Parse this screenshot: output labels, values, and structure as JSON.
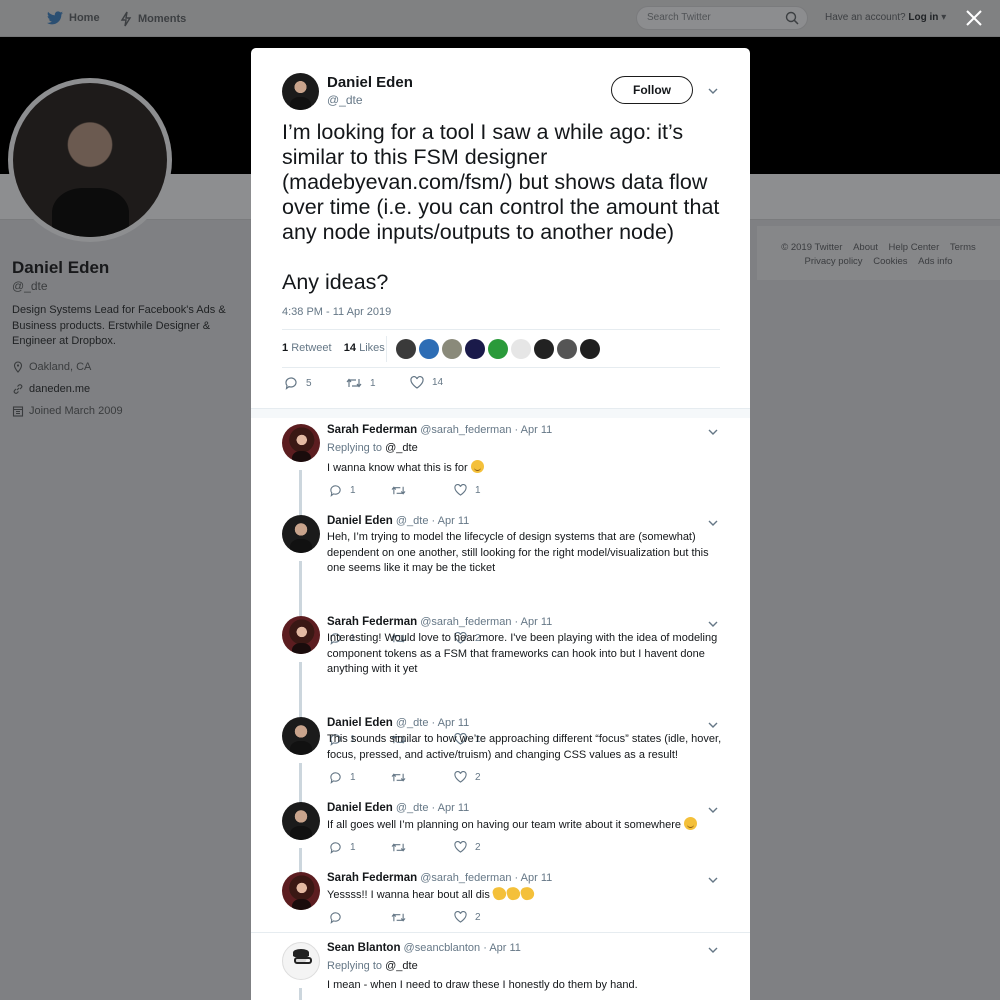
{
  "nav": {
    "home": "Home",
    "moments": "Moments",
    "search_placeholder": "Search Twitter",
    "account_prompt": "Have an account?",
    "login": "Log in"
  },
  "profile": {
    "name": "Daniel Eden",
    "handle": "@_dte",
    "bio": "Design Systems Lead for Facebook's Ads & Business products. Erstwhile Designer & Engineer at Dropbox.",
    "location": "Oakland, CA",
    "website": "daneden.me",
    "joined": "Joined March 2009"
  },
  "footer": {
    "links_row1": [
      "© 2019 Twitter",
      "About",
      "Help Center",
      "Terms"
    ],
    "links_row2": [
      "Privacy policy",
      "Cookies",
      "Ads info"
    ]
  },
  "tweet": {
    "name": "Daniel Eden",
    "handle": "@_dte",
    "follow_label": "Follow",
    "text": "I’m looking for a tool I saw a while ago: it’s similar to this FSM designer (madebyevan.com/fsm/) but shows data flow over time (i.e. you can control the amount that any node inputs/outputs to another node)\n\nAny ideas?",
    "time": "4:38 PM - 11 Apr 2019",
    "retweet_count": "1",
    "retweet_label": "Retweet",
    "like_count": "14",
    "like_label": "Likes",
    "actions": {
      "replies": "5",
      "retweets": "1",
      "likes": "14"
    },
    "likers_colors": [
      "#3a3a3a",
      "#2d6db5",
      "#8a8a7a",
      "#1a1a4a",
      "#2a9a3a",
      "#e6e6e6",
      "#222222",
      "#555555",
      "#1f1f1f"
    ]
  },
  "replies": [
    {
      "name": "Sarah Federman",
      "handle": "@sarah_federman",
      "date": "· Apr 11",
      "replying_prefix": "Replying to",
      "replying_to": "@_dte",
      "text": "I wanna know what this is for",
      "replies": "1",
      "likes": "1"
    },
    {
      "name": "Daniel Eden",
      "handle": "@_dte",
      "date": "· Apr 11",
      "text": "Heh, I’m trying to model the lifecycle of design systems that are (somewhat) dependent on one another, still looking for the right model/visualization but this one seems like it may be the ticket",
      "replies": "1",
      "likes": "2"
    },
    {
      "name": "Sarah Federman",
      "handle": "@sarah_federman",
      "date": "· Apr 11",
      "text": "Interesting! Would love to hear more. I've been playing with the idea of modeling component tokens as a FSM that frameworks can hook into but I havent done anything with it yet",
      "replies": "1",
      "likes": "1"
    },
    {
      "name": "Daniel Eden",
      "handle": "@_dte",
      "date": "· Apr 11",
      "text": "This sounds similar to how we’re approaching different “focus” states (idle, hover, focus, pressed, and active/truism) and changing CSS values as a result!",
      "replies": "1",
      "likes": "2"
    },
    {
      "name": "Daniel Eden",
      "handle": "@_dte",
      "date": "· Apr 11",
      "text": "If all goes well I’m planning on having our team write about it somewhere",
      "replies": "1",
      "likes": "2"
    },
    {
      "name": "Sarah Federman",
      "handle": "@sarah_federman",
      "date": "· Apr 11",
      "text": "Yessss!! I wanna hear bout all dis",
      "replies": "",
      "likes": "2"
    },
    {
      "name": "Sean Blanton",
      "handle": "@seancblanton",
      "date": "· Apr 11",
      "replying_prefix": "Replying to",
      "replying_to": "@_dte",
      "text": "I mean - when I need to draw these I honestly do them by hand."
    }
  ],
  "colors": {
    "twitter_blue": "#1da1f2",
    "muted": "#657786",
    "text": "#14171a",
    "overlay": "#7f8083"
  }
}
